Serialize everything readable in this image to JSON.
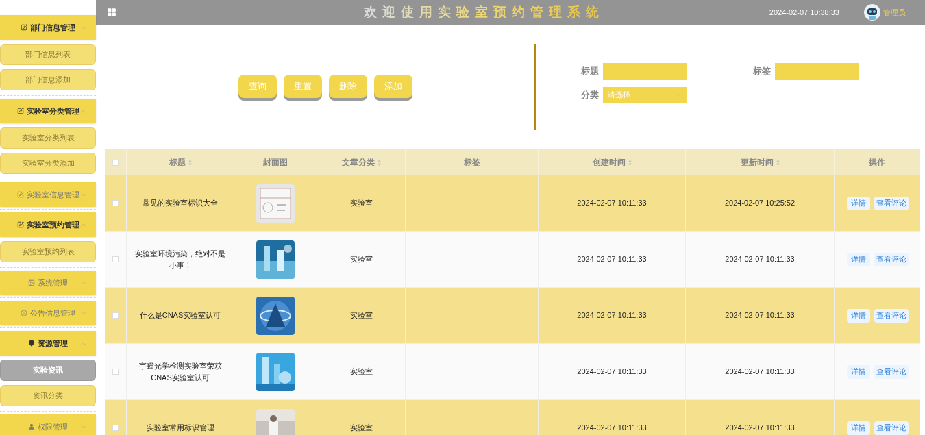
{
  "sidebar": {
    "items": [
      {
        "label": "部门信息管理",
        "kind": "document",
        "expanded": true,
        "children": [
          {
            "label": "部门信息列表",
            "selected": false
          },
          {
            "label": "部门信息添加",
            "selected": false
          }
        ]
      },
      {
        "label": "实验室分类管理",
        "kind": "document",
        "expanded": true,
        "children": [
          {
            "label": "实验室分类列表",
            "selected": false
          },
          {
            "label": "实验室分类添加",
            "selected": false
          }
        ]
      },
      {
        "label": "实验室信息管理",
        "kind": "document",
        "expanded": false
      },
      {
        "label": "实验室预约管理",
        "kind": "document",
        "expanded": true,
        "children": [
          {
            "label": "实验室预约列表",
            "selected": false
          }
        ]
      },
      {
        "label": "系统管理",
        "expanded": false
      },
      {
        "label": "公告信息管理",
        "kind": "info",
        "expanded": false
      },
      {
        "label": "资源管理",
        "kind": "pin",
        "expanded": true,
        "children": [
          {
            "label": "实验资讯",
            "selected": true
          },
          {
            "label": "资讯分类",
            "selected": false
          }
        ]
      },
      {
        "label": "权限管理",
        "kind": "user",
        "expanded": false
      }
    ]
  },
  "header": {
    "title": "欢迎使用实验室预约管理系统",
    "datetime": "2024-02-07 10:38:33",
    "user": "管理员"
  },
  "actions": [
    "查询",
    "重置",
    "删除",
    "添加"
  ],
  "filters": [
    {
      "label": "标题",
      "kind": "text"
    },
    {
      "label": "标签",
      "kind": "text"
    },
    {
      "label": "分类",
      "kind": "select",
      "placeholder": "请选择"
    }
  ],
  "table": {
    "header_checkbox": {
      "checked": false
    },
    "columns": [
      {
        "label": "标题",
        "sortable": true
      },
      {
        "label": "封面图",
        "sortable": false
      },
      {
        "label": "文章分类",
        "sortable": true
      },
      {
        "label": "标签",
        "sortable": false
      },
      {
        "label": "创建时间",
        "sortable": true
      },
      {
        "label": "更新时间",
        "sortable": true
      },
      {
        "label": "操作",
        "sortable": false
      }
    ],
    "rows": [
      {
        "checked": false,
        "title": "常见的实验室标识大全",
        "cover": {
          "kind": "picture"
        },
        "category": "实验室",
        "created": "2024-02-07 10:11:33",
        "updated": "2024-02-07 10:25:52",
        "buttons": [
          "详情",
          "查看评论"
        ]
      },
      {
        "checked": false,
        "title": "实验室环境污染，绝对不是小事！",
        "cover": {
          "kind": "picture"
        },
        "category": "实验室",
        "created": "2024-02-07 10:11:33",
        "updated": "2024-02-07 10:11:33",
        "buttons": [
          "详情",
          "查看评论"
        ]
      },
      {
        "checked": false,
        "title": "什么是CNAS实验室认可",
        "cover": {
          "kind": "picture"
        },
        "category": "实验室",
        "created": "2024-02-07 10:11:33",
        "updated": "2024-02-07 10:11:33",
        "buttons": [
          "详情",
          "查看评论"
        ]
      },
      {
        "checked": false,
        "title": "宇瞳光学检测实验室荣获CNAS实验室认可",
        "cover": {
          "kind": "picture"
        },
        "category": "实验室",
        "created": "2024-02-07 10:11:33",
        "updated": "2024-02-07 10:11:33",
        "buttons": [
          "详情",
          "查看评论"
        ]
      },
      {
        "checked": false,
        "title": "实验室常用标识管理",
        "cover": {
          "kind": "picture"
        },
        "category": "实验室",
        "created": "2024-02-07 10:11:33",
        "updated": "2024-02-07 10:11:33",
        "buttons": [
          "详情",
          "查看评论"
        ]
      }
    ]
  }
}
